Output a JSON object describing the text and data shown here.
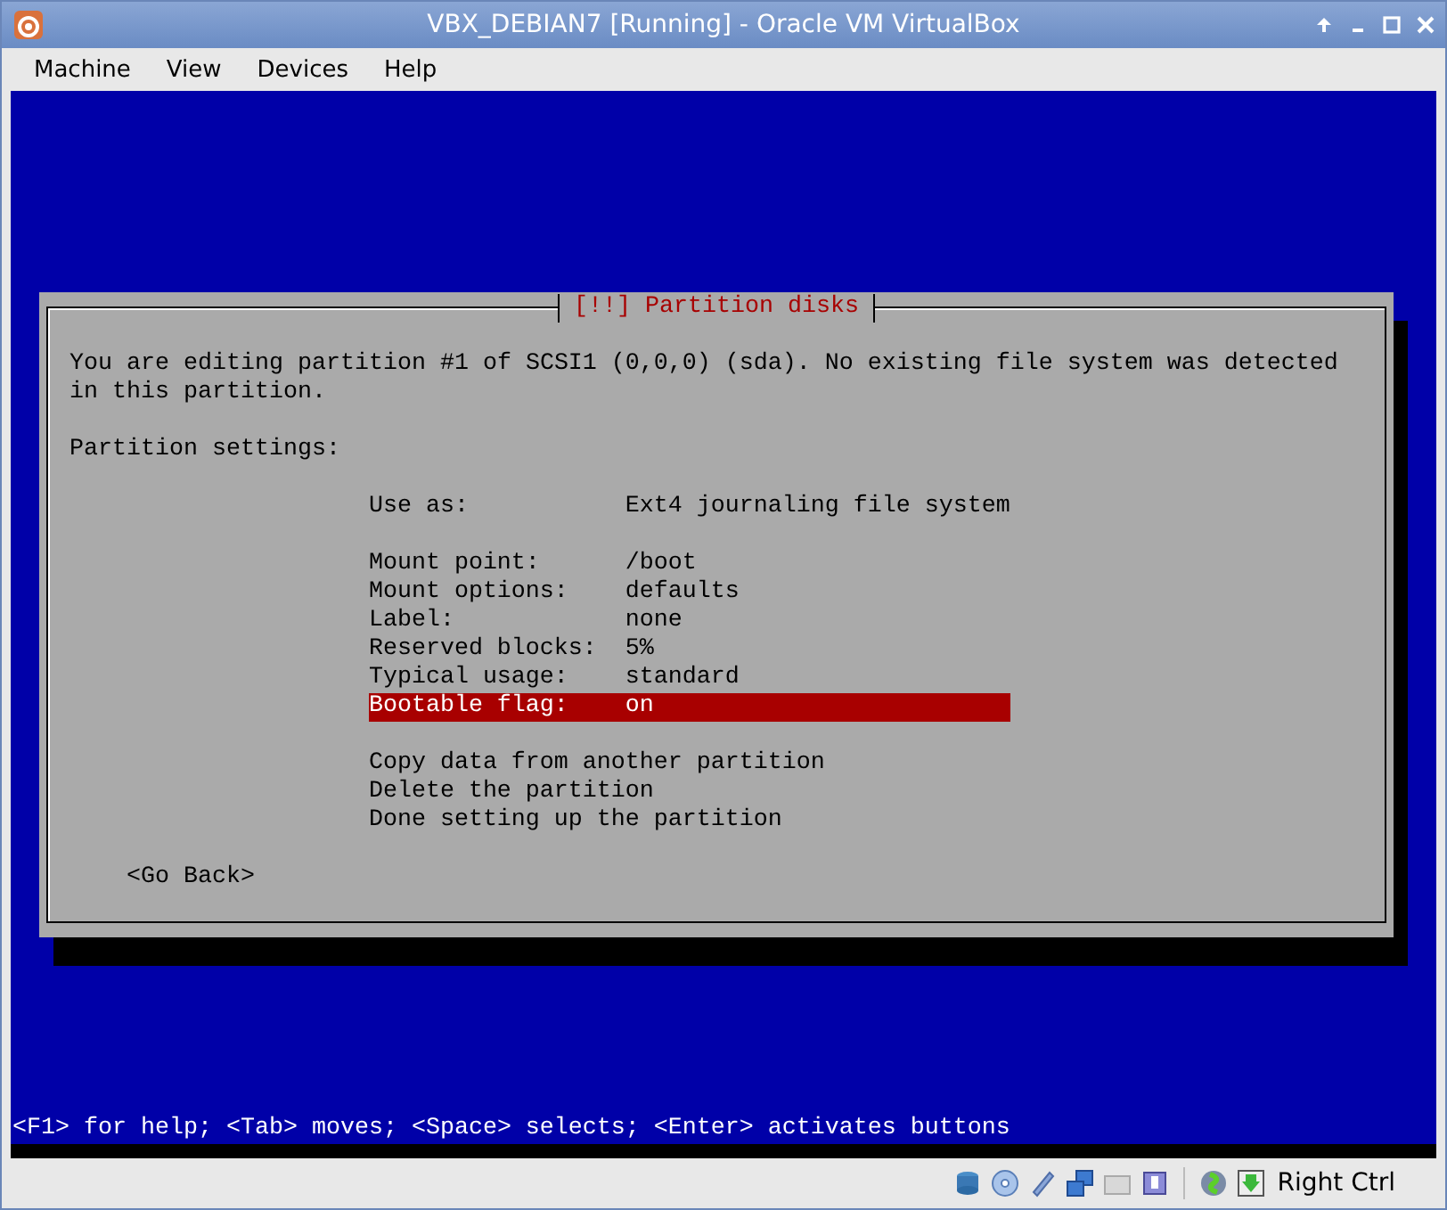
{
  "window": {
    "title": "VBX_DEBIAN7 [Running] - Oracle VM VirtualBox"
  },
  "menu": [
    "Machine",
    "View",
    "Devices",
    "Help"
  ],
  "dialog": {
    "title": "[!!] Partition disks",
    "intro": "You are editing partition #1 of SCSI1 (0,0,0) (sda). No existing file system was detected in this partition.",
    "section": "Partition settings:",
    "groups": [
      [
        {
          "kind": "setting",
          "label": "Use as:",
          "value": "Ext4 journaling file system",
          "selected": false
        }
      ],
      [
        {
          "kind": "setting",
          "label": "Mount point:",
          "value": "/boot",
          "selected": false
        },
        {
          "kind": "setting",
          "label": "Mount options:",
          "value": "defaults",
          "selected": false
        },
        {
          "kind": "setting",
          "label": "Label:",
          "value": "none",
          "selected": false
        },
        {
          "kind": "setting",
          "label": "Reserved blocks:",
          "value": "5%",
          "selected": false
        },
        {
          "kind": "setting",
          "label": "Typical usage:",
          "value": "standard",
          "selected": false
        },
        {
          "kind": "setting",
          "label": "Bootable flag:",
          "value": "on",
          "selected": true
        }
      ],
      [
        {
          "kind": "action",
          "label": "Copy data from another partition",
          "selected": false
        },
        {
          "kind": "action",
          "label": "Delete the partition",
          "selected": false
        },
        {
          "kind": "action",
          "label": "Done setting up the partition",
          "selected": false
        }
      ]
    ],
    "back_button": "<Go Back>"
  },
  "help_line": "<F1> for help; <Tab> moves; <Space> selects; <Enter> activates buttons",
  "status_bar": {
    "host_key": "Right Ctrl"
  }
}
